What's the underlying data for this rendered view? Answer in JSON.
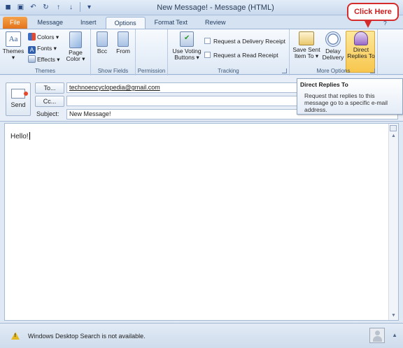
{
  "window": {
    "title": "New Message! - Message (HTML)"
  },
  "tabs": [
    "File",
    "Message",
    "Insert",
    "Options",
    "Format Text",
    "Review"
  ],
  "ribbon": {
    "themes": {
      "themes_label": "Themes",
      "colors_label": "Colors",
      "fonts_label": "Fonts",
      "effects_label": "Effects",
      "page_color_label": "Page Color",
      "group_label": "Themes"
    },
    "show_fields": {
      "bcc_label": "Bcc",
      "from_label": "From",
      "group_label": "Show Fields"
    },
    "permission": {
      "group_label": "Permission"
    },
    "tracking": {
      "use_voting_label": "Use Voting Buttons",
      "delivery_receipt_label": "Request a Delivery Receipt",
      "read_receipt_label": "Request a Read Receipt",
      "group_label": "Tracking"
    },
    "more_options": {
      "save_sent_label": "Save Sent Item To",
      "delay_delivery_label": "Delay Delivery",
      "direct_replies_label": "Direct Replies To",
      "group_label": "More Options"
    }
  },
  "callout": {
    "text": "Click Here"
  },
  "compose": {
    "send_label": "Send",
    "to_label": "To...",
    "to_value": "technoencyclopedia@gmail.com",
    "cc_label": "Cc...",
    "cc_value": "",
    "subject_label": "Subject:",
    "subject_value": "New Message!",
    "body_text": "Hello!"
  },
  "tooltip": {
    "title": "Direct Replies To",
    "body": "Request that replies to this message go to a specific e-mail address."
  },
  "statusbar": {
    "text": "Windows Desktop Search is not available."
  },
  "colors": {
    "file_tab": "#e2731c",
    "callout_border": "#d52b2b",
    "highlight": "#f7c64d"
  }
}
